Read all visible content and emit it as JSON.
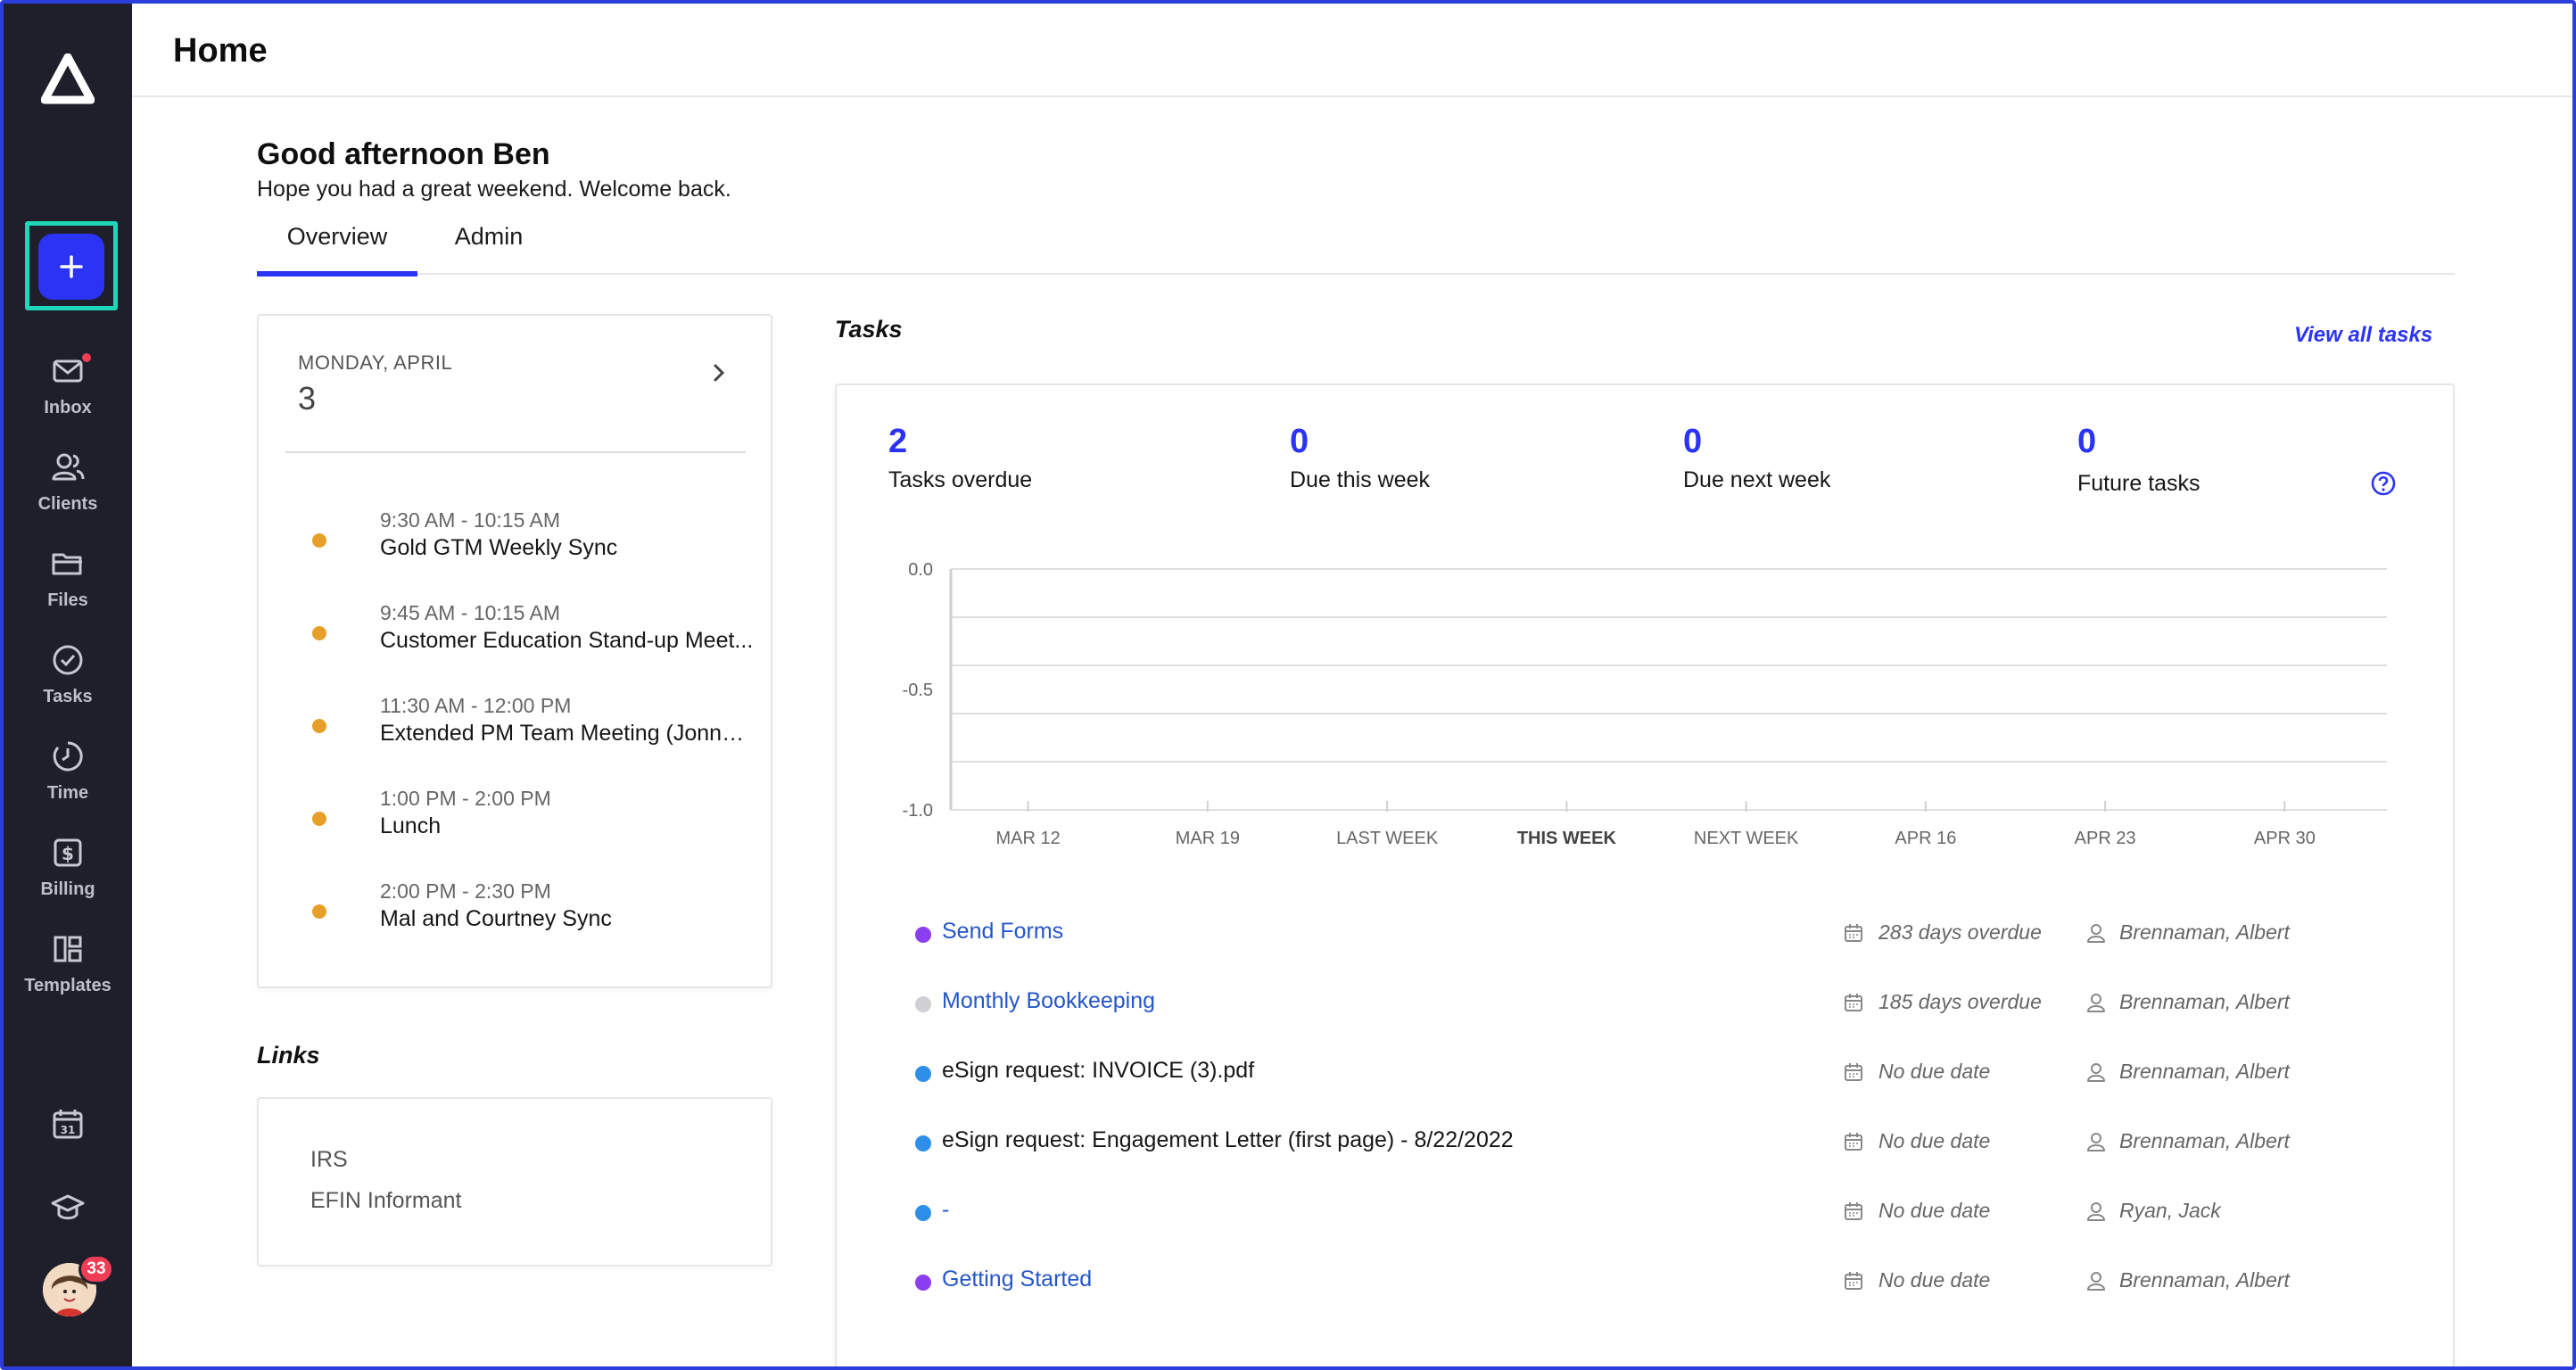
{
  "app": {
    "page_title": "Home"
  },
  "sidebar": {
    "items": [
      {
        "label": "Inbox",
        "icon": "mail-icon"
      },
      {
        "label": "Clients",
        "icon": "users-icon"
      },
      {
        "label": "Files",
        "icon": "folder-icon"
      },
      {
        "label": "Tasks",
        "icon": "check-circle-icon"
      },
      {
        "label": "Time",
        "icon": "clock-icon"
      },
      {
        "label": "Billing",
        "icon": "dollar-icon"
      },
      {
        "label": "Templates",
        "icon": "layout-icon"
      }
    ],
    "calendar_day": "31",
    "avatar_badge": "33",
    "colors": {
      "background": "#1f1f2b",
      "accent": "#2b33f5",
      "highlight": "#1fd6b8",
      "badge": "#ef3d56"
    }
  },
  "greeting": {
    "title": "Good afternoon Ben",
    "subtitle": "Hope you had a great weekend. Welcome back."
  },
  "tabs": [
    {
      "label": "Overview",
      "active": true
    },
    {
      "label": "Admin",
      "active": false
    }
  ],
  "calendar": {
    "day_label": "MONDAY, APRIL",
    "day_number": "3",
    "events": [
      {
        "time": "9:30 AM - 10:15 AM",
        "title": "Gold GTM Weekly Sync"
      },
      {
        "time": "9:45 AM - 10:15 AM",
        "title": "Customer Education Stand-up Meet..."
      },
      {
        "time": "11:30 AM - 12:00 PM",
        "title": "Extended PM Team Meeting (Jonny ..."
      },
      {
        "time": "1:00 PM - 2:00 PM",
        "title": "Lunch"
      },
      {
        "time": "2:00 PM - 2:30 PM",
        "title": "Mal and Courtney Sync"
      }
    ]
  },
  "links": {
    "title": "Links",
    "items": [
      "IRS",
      "EFIN Informant"
    ]
  },
  "tasks": {
    "title": "Tasks",
    "view_all": "View all tasks",
    "stats": [
      {
        "value": "2",
        "label": "Tasks overdue"
      },
      {
        "value": "0",
        "label": "Due this week"
      },
      {
        "value": "0",
        "label": "Due next week"
      },
      {
        "value": "0",
        "label": "Future tasks"
      }
    ],
    "list": [
      {
        "name": "Send Forms",
        "due": "283 days overdue",
        "assignee": "Brennaman, Albert",
        "dot_color": "#8b3df0",
        "link": true
      },
      {
        "name": "Monthly Bookkeeping",
        "due": "185 days overdue",
        "assignee": "Brennaman, Albert",
        "dot_color": "#cfcfd4",
        "link": true
      },
      {
        "name": "eSign request: INVOICE (3).pdf",
        "due": "No due date",
        "assignee": "Brennaman, Albert",
        "dot_color": "#2f8ee8",
        "link": false
      },
      {
        "name": "eSign request: Engagement Letter (first page) - 8/22/2022",
        "due": "No due date",
        "assignee": "Brennaman, Albert",
        "dot_color": "#2f8ee8",
        "link": false
      },
      {
        "name": "-",
        "due": "No due date",
        "assignee": "Ryan, Jack",
        "dot_color": "#2f8ee8",
        "link": true
      },
      {
        "name": "Getting Started",
        "due": "No due date",
        "assignee": "Brennaman, Albert",
        "dot_color": "#8b3df0",
        "link": true
      }
    ]
  },
  "chart_data": {
    "type": "bar",
    "categories": [
      "MAR 12",
      "MAR 19",
      "LAST WEEK",
      "THIS WEEK",
      "NEXT WEEK",
      "APR 16",
      "APR 23",
      "APR 30"
    ],
    "highlight_category": "THIS WEEK",
    "values": [
      0,
      0,
      0,
      0,
      0,
      0,
      0,
      0
    ],
    "ylim": [
      -1.0,
      0.0
    ],
    "yticks": [
      "0.0",
      "-0.5",
      "-1.0"
    ],
    "grid": true,
    "title": "",
    "xlabel": "",
    "ylabel": ""
  }
}
